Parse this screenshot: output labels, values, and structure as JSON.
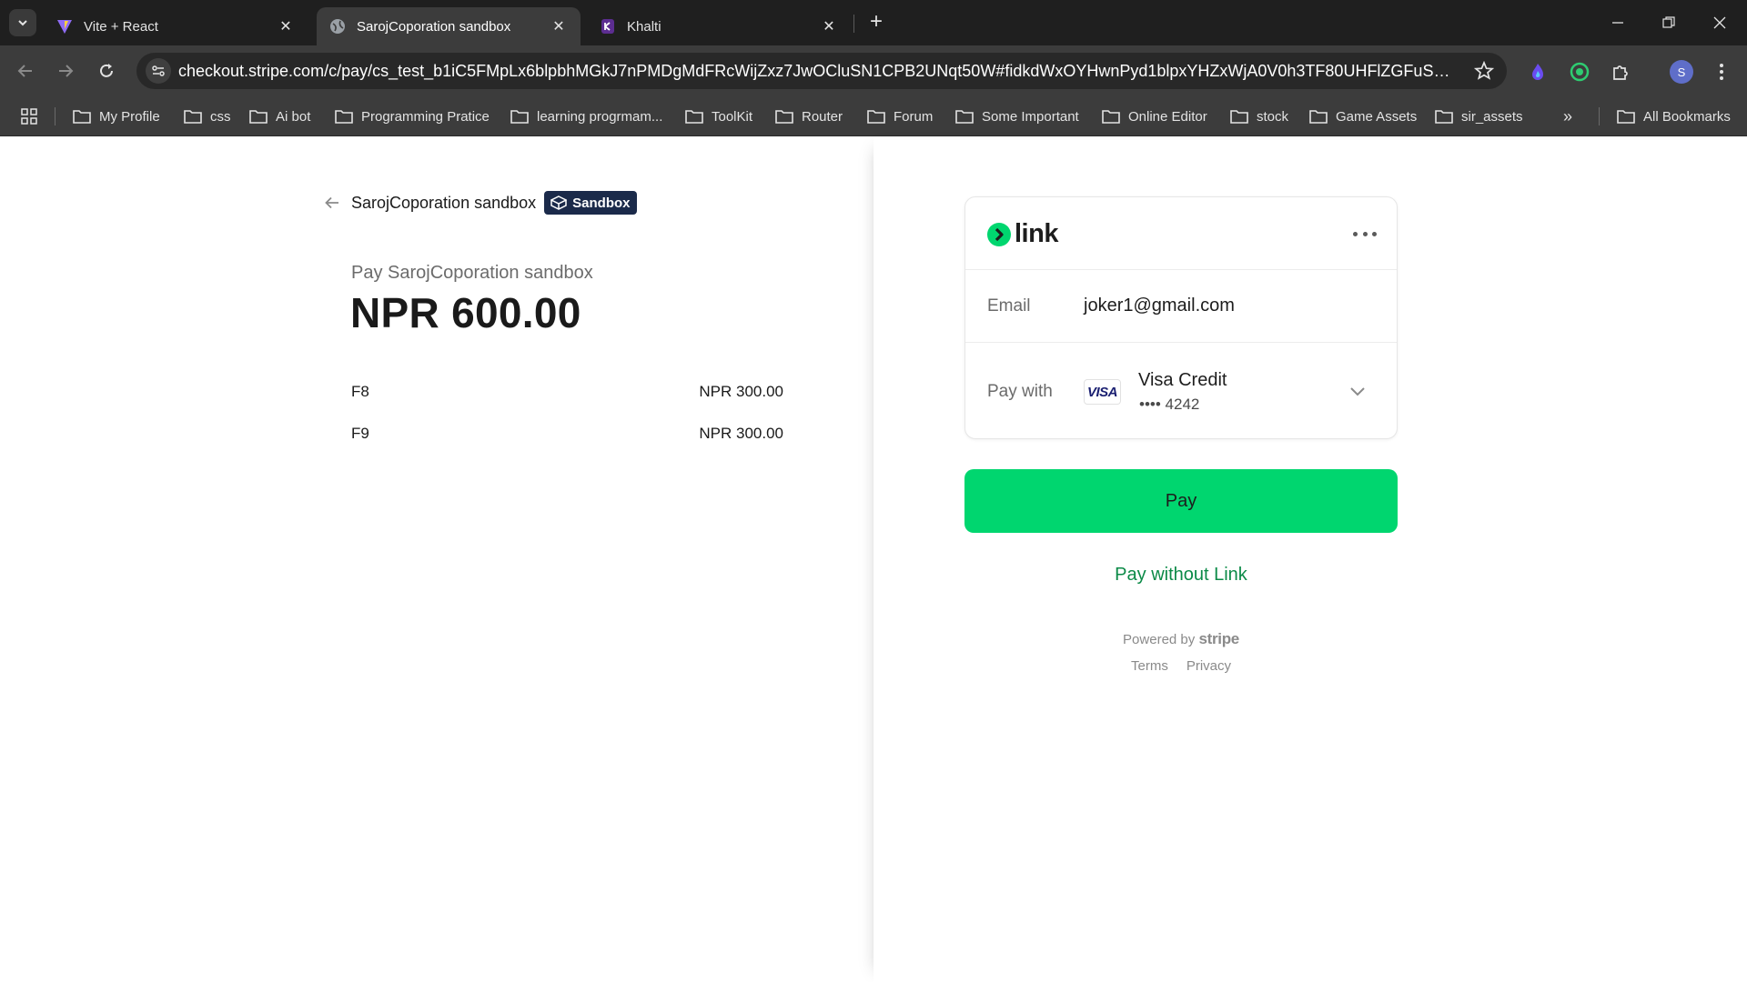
{
  "browser": {
    "tabs": [
      {
        "title": "Vite + React",
        "active": false
      },
      {
        "title": "SarojCoporation sandbox",
        "active": true
      },
      {
        "title": "Khalti",
        "active": false
      }
    ],
    "url": "checkout.stripe.com/c/pay/cs_test_b1iC5FMpLx6blpbhMGkJ7nPMDgMdFRcWijZxz7JwOCluSN1CPB2UNqt50W#fidkdWxOYHwnPyd1blpxYHZxWjA0V0h3TF80UHFlZGFuSzduU1FWT1...",
    "profile_initial": "S",
    "bookmarks": [
      "My Profile",
      "css",
      "Ai bot",
      "Programming Pratice",
      "learning progrmam...",
      "ToolKit",
      "Router",
      "Forum",
      "Some Important",
      "Online Editor",
      "stock",
      "Game Assets",
      "sir_assets"
    ],
    "all_bookmarks": "All Bookmarks",
    "overflow": "»"
  },
  "summary": {
    "merchant": "SarojCoporation sandbox",
    "badge": "Sandbox",
    "pay_label": "Pay SarojCoporation sandbox",
    "amount": "NPR 600.00",
    "items": [
      {
        "name": "F8",
        "price": "NPR 300.00"
      },
      {
        "name": "F9",
        "price": "NPR 300.00"
      }
    ]
  },
  "link": {
    "brand": "link",
    "email_label": "Email",
    "email": "joker1@gmail.com",
    "paywith_label": "Pay with",
    "card_brand": "VISA",
    "card_name": "Visa Credit",
    "card_last4": "•••• 4242"
  },
  "actions": {
    "pay": "Pay",
    "pay_without": "Pay without Link"
  },
  "footer": {
    "powered_by": "Powered by",
    "stripe": "stripe",
    "terms": "Terms",
    "privacy": "Privacy"
  },
  "colors": {
    "link_green": "#00d66f",
    "link_text_green": "#0b8a47",
    "sandbox_badge": "#1b2a4a"
  }
}
